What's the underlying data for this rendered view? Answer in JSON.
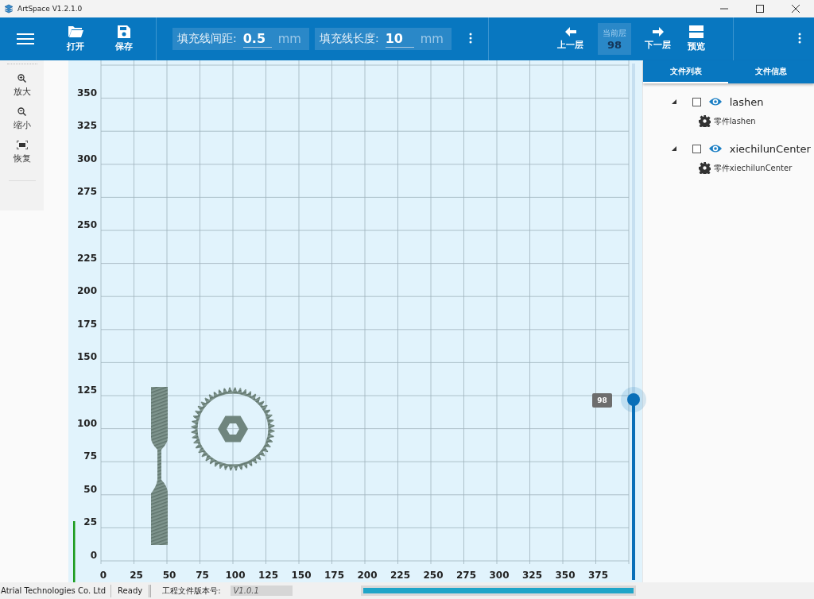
{
  "window": {
    "title": "ArtSpace V1.2.1.0"
  },
  "toolbar": {
    "left": [
      {
        "kind": "menu"
      },
      {
        "kind": "open",
        "label": "打开"
      },
      {
        "kind": "save",
        "label": "保存"
      }
    ],
    "fields": [
      {
        "label": "填充线间距:",
        "value": "0.5",
        "unit": "mm"
      },
      {
        "label": "填充线长度:",
        "value": "10",
        "unit": "mm"
      }
    ],
    "layer_nav": {
      "prev": "上一层",
      "current_caption": "当前层",
      "current_value": "98",
      "next": "下一层",
      "preview": "预览"
    }
  },
  "zoom_tools": [
    {
      "kind": "zoom_in",
      "label": "放大"
    },
    {
      "kind": "zoom_out",
      "label": "缩小"
    },
    {
      "kind": "reset",
      "label": "恢复"
    }
  ],
  "canvas": {
    "y_ticks": [
      "350",
      "325",
      "300",
      "275",
      "250",
      "225",
      "200",
      "175",
      "150",
      "125",
      "100",
      "75",
      "50",
      "25",
      "0"
    ],
    "x_ticks": [
      "0",
      "25",
      "50",
      "75",
      "100",
      "125",
      "150",
      "175",
      "200",
      "225",
      "250",
      "275",
      "300",
      "325",
      "350",
      "375"
    ],
    "layer_slider": {
      "level": 0.35,
      "value_label": "98"
    }
  },
  "tabs": [
    {
      "label": "文件列表",
      "selected": true
    },
    {
      "label": "文件信息",
      "selected": false
    }
  ],
  "file_tree": [
    {
      "name": "lashen",
      "checked": false,
      "visible": true,
      "expanded": true,
      "children": [
        {
          "name": "零件lashen"
        }
      ]
    },
    {
      "name": "xiechilunCenter",
      "checked": false,
      "visible": true,
      "expanded": true,
      "children": [
        {
          "name": "零件xiechilunCenter"
        }
      ]
    }
  ],
  "status_bar": {
    "company": "Atrial Technologies Co. Ltd",
    "state": "Ready",
    "version_label": "工程文件版本号:",
    "version_value": "V1.0.1",
    "progress": {
      "level": 1
    }
  }
}
